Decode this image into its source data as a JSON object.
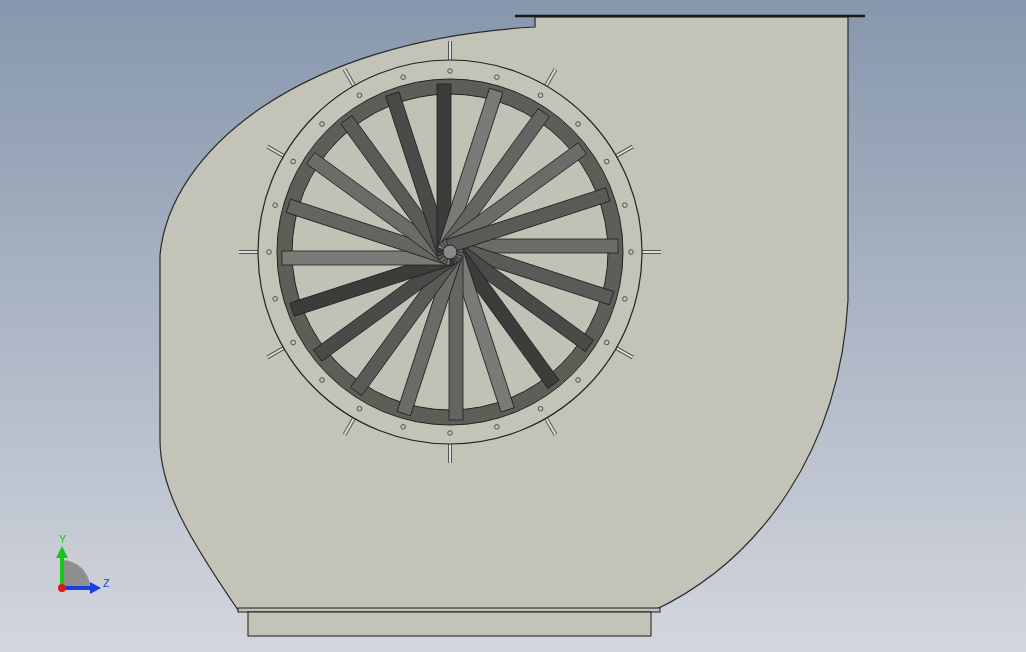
{
  "viewport": {
    "triad": {
      "axes": [
        {
          "kind": "vertical",
          "label": "Y",
          "color": "#18c818"
        },
        {
          "kind": "horizontal",
          "label": "Z",
          "color": "#1a3ce0"
        }
      ]
    }
  }
}
